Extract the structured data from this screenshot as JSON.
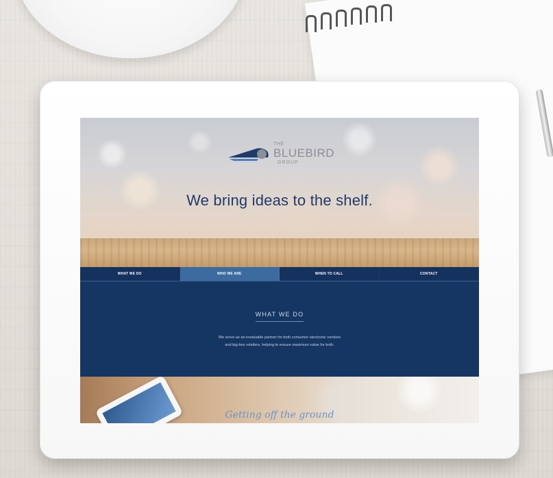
{
  "site": {
    "logo": {
      "the": "THE",
      "name": "BLUEBIRD",
      "group": "GROUP"
    },
    "tagline": "We bring ideas to the shelf.",
    "nav": [
      {
        "label": "WHAT WE DO",
        "active": false
      },
      {
        "label": "WHO WE ARE",
        "active": true
      },
      {
        "label": "WHEN TO CALL",
        "active": false
      },
      {
        "label": "CONTACT",
        "active": false
      }
    ],
    "section": {
      "title": "WHAT WE DO",
      "body_line1": "We serve as an invaluable partner for both consumer electronic vendors",
      "body_line2": "and big-box retailers, helping to ensure maximum value for both."
    },
    "photo_caption": "Getting off the ground"
  },
  "colors": {
    "navy": "#153563",
    "nav_active": "#3c6ba0",
    "tagline": "#213a68",
    "caption": "#6c95c4"
  },
  "icons": {
    "logo_mark": "bluebird-logo-icon"
  }
}
